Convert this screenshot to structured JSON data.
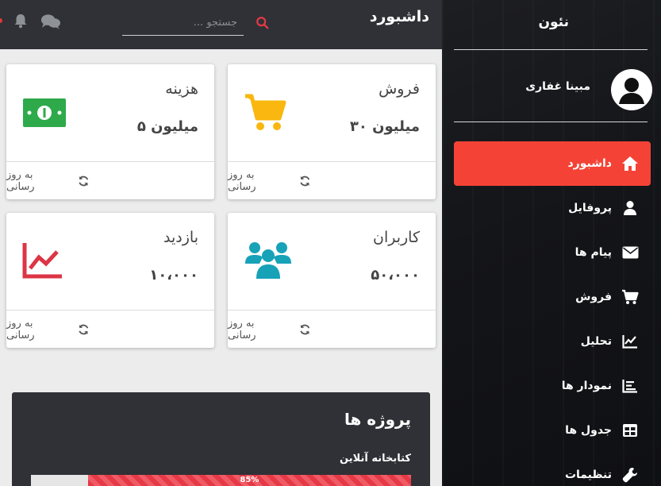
{
  "header": {
    "title": "داشبورد",
    "search_placeholder": "جستجو ..."
  },
  "sidebar": {
    "brand": "نئون",
    "user_name": "مبینا غفاری",
    "items": [
      {
        "label": "داشبورد",
        "icon": "home-icon",
        "active": true
      },
      {
        "label": "پروفایل",
        "icon": "user-icon"
      },
      {
        "label": "پیام ها",
        "icon": "envelope-icon"
      },
      {
        "label": "فروش",
        "icon": "cart-icon"
      },
      {
        "label": "تحلیل",
        "icon": "line-chart-icon"
      },
      {
        "label": "نمودار ها",
        "icon": "bar-chart-icon"
      },
      {
        "label": "جدول ها",
        "icon": "table-icon"
      },
      {
        "label": "تنظیمات",
        "icon": "wrench-icon"
      }
    ]
  },
  "cards": [
    {
      "title": "فروش",
      "value": "۳۰ میلیون",
      "footer": "به روز رسانی",
      "icon": "cart-icon",
      "color": "#f9b70f"
    },
    {
      "title": "هزینه",
      "value": "۵ میلیون",
      "footer": "به روز رسانی",
      "icon": "money-icon",
      "color": "#2eaa4a"
    },
    {
      "title": "کاربران",
      "value": "۵۰،۰۰۰",
      "footer": "به روز رسانی",
      "icon": "users-icon",
      "color": "#17a2b8"
    },
    {
      "title": "بازدید",
      "value": "۱۰،۰۰۰",
      "footer": "به روز رسانی",
      "icon": "chart-line-icon",
      "color": "#dc3545"
    }
  ],
  "projects": {
    "title": "پروژه ها",
    "items": [
      {
        "name": "کتابخانه آنلاین",
        "progress": 85,
        "progress_label": "85%"
      }
    ]
  },
  "colors": {
    "accent": "#f44336",
    "topbar": "#2f3136",
    "sidebar": "#141519"
  }
}
